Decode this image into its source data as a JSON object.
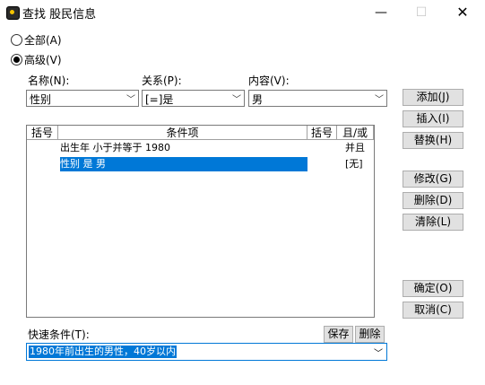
{
  "window": {
    "title": "查找 股民信息",
    "minimize": "—",
    "maximize": "☐",
    "close": "✕"
  },
  "mode": {
    "all_label": "全部(A)",
    "advanced_label": "高级(V)",
    "selected": "advanced"
  },
  "fields": {
    "name_label": "名称(N):",
    "relation_label": "关系(P):",
    "content_label": "内容(V):",
    "name_value": "性别",
    "relation_value": "[=]是",
    "content_value": "男",
    "arrow": "﹀"
  },
  "table": {
    "headers": [
      "括号",
      "条件项",
      "括号",
      "且/或"
    ],
    "rows": [
      {
        "open": "",
        "condition": "出生年 小于并等于 1980",
        "close": "",
        "logic": "并且",
        "selected": false
      },
      {
        "open": "",
        "condition": "性别 是 男",
        "close": "",
        "logic": "[无]",
        "selected": true
      }
    ]
  },
  "buttons": {
    "add": "添加(J)",
    "insert": "插入(I)",
    "replace": "替换(H)",
    "modify": "修改(G)",
    "delete": "删除(D)",
    "clear": "清除(L)",
    "ok": "确定(O)",
    "cancel": "取消(C)",
    "save": "保存",
    "remove": "删除"
  },
  "quick": {
    "label": "快速条件(T):",
    "value": "1980年前出生的男性，40岁以内",
    "arrow": "﹀"
  },
  "colors": {
    "selection": "#0078d7",
    "button_bg": "#e1e1e1"
  }
}
